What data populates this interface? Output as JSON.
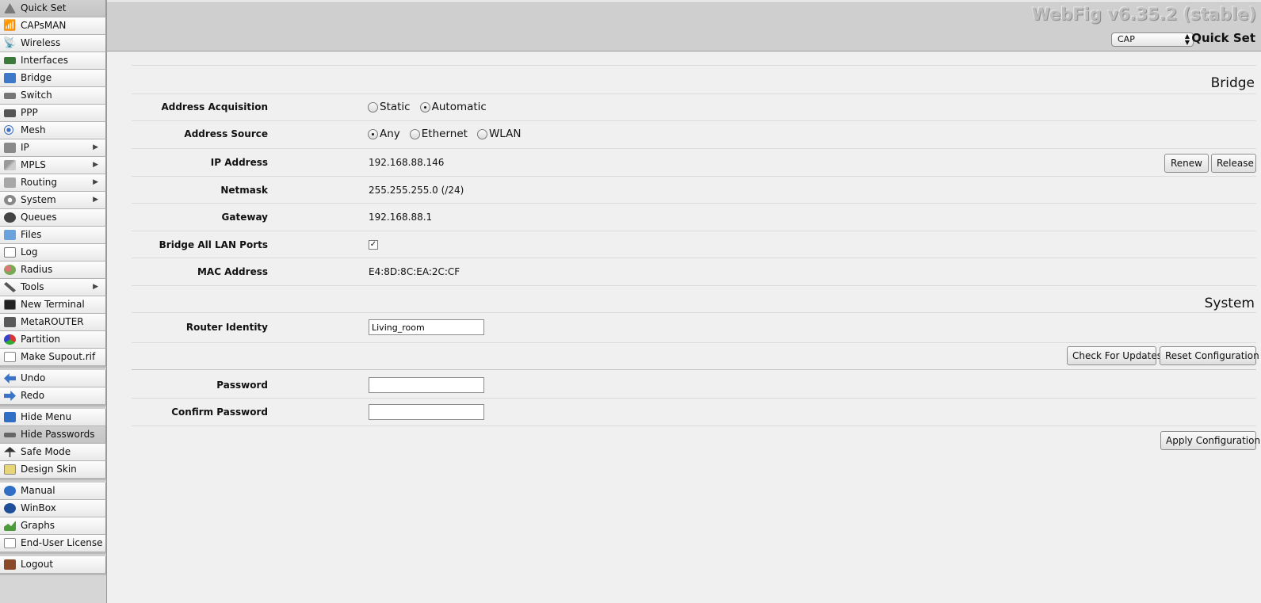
{
  "app": {
    "title": "WebFig v6.35.2 (stable)"
  },
  "header": {
    "mode_value": "CAP",
    "page_title": "Quick Set"
  },
  "sidebar": {
    "group1": [
      {
        "label": "Quick Set",
        "icon": "quickset-icon",
        "active": true
      },
      {
        "label": "CAPsMAN",
        "icon": "capsman-icon"
      },
      {
        "label": "Wireless",
        "icon": "wireless-icon"
      },
      {
        "label": "Interfaces",
        "icon": "interfaces-icon"
      },
      {
        "label": "Bridge",
        "icon": "bridge-icon"
      },
      {
        "label": "Switch",
        "icon": "switch-icon"
      },
      {
        "label": "PPP",
        "icon": "ppp-icon"
      },
      {
        "label": "Mesh",
        "icon": "mesh-icon"
      },
      {
        "label": "IP",
        "icon": "ip-icon",
        "submenu": true
      },
      {
        "label": "MPLS",
        "icon": "mpls-icon",
        "submenu": true
      },
      {
        "label": "Routing",
        "icon": "routing-icon",
        "submenu": true
      },
      {
        "label": "System",
        "icon": "system-icon",
        "submenu": true
      },
      {
        "label": "Queues",
        "icon": "queues-icon"
      },
      {
        "label": "Files",
        "icon": "files-icon"
      },
      {
        "label": "Log",
        "icon": "log-icon"
      },
      {
        "label": "Radius",
        "icon": "radius-icon"
      },
      {
        "label": "Tools",
        "icon": "tools-icon",
        "submenu": true
      },
      {
        "label": "New Terminal",
        "icon": "terminal-icon"
      },
      {
        "label": "MetaROUTER",
        "icon": "metarouter-icon"
      },
      {
        "label": "Partition",
        "icon": "partition-icon"
      },
      {
        "label": "Make Supout.rif",
        "icon": "supout-icon"
      }
    ],
    "group2": [
      {
        "label": "Undo",
        "icon": "undo-icon"
      },
      {
        "label": "Redo",
        "icon": "redo-icon"
      }
    ],
    "group3": [
      {
        "label": "Hide Menu",
        "icon": "hide-menu-icon"
      },
      {
        "label": "Hide Passwords",
        "icon": "hide-passwords-icon",
        "active": true
      },
      {
        "label": "Safe Mode",
        "icon": "safe-mode-icon"
      },
      {
        "label": "Design Skin",
        "icon": "design-skin-icon"
      }
    ],
    "group4": [
      {
        "label": "Manual",
        "icon": "manual-icon"
      },
      {
        "label": "WinBox",
        "icon": "winbox-icon"
      },
      {
        "label": "Graphs",
        "icon": "graphs-icon"
      },
      {
        "label": "End-User License",
        "icon": "license-icon"
      }
    ],
    "group5": [
      {
        "label": "Logout",
        "icon": "logout-icon"
      }
    ]
  },
  "bridge": {
    "section_title": "Bridge",
    "address_acquisition": {
      "label": "Address Acquisition",
      "options": [
        "Static",
        "Automatic"
      ],
      "selected": "Automatic"
    },
    "address_source": {
      "label": "Address Source",
      "options": [
        "Any",
        "Ethernet",
        "WLAN"
      ],
      "selected": "Any"
    },
    "ip_address": {
      "label": "IP Address",
      "value": "192.168.88.146"
    },
    "renew_label": "Renew",
    "release_label": "Release",
    "netmask": {
      "label": "Netmask",
      "value": "255.255.255.0 (/24)"
    },
    "gateway": {
      "label": "Gateway",
      "value": "192.168.88.1"
    },
    "bridge_all": {
      "label": "Bridge All LAN Ports",
      "checked": true
    },
    "mac": {
      "label": "MAC Address",
      "value": "E4:8D:8C:EA:2C:CF"
    }
  },
  "system": {
    "section_title": "System",
    "router_identity": {
      "label": "Router Identity",
      "value": "Living_room"
    },
    "check_updates_label": "Check For Updates",
    "reset_label": "Reset Configuration",
    "password": {
      "label": "Password",
      "value": ""
    },
    "confirm_password": {
      "label": "Confirm Password",
      "value": ""
    },
    "apply_label": "Apply Configuration"
  },
  "colors": {
    "header_bg": "#cfcfcf",
    "page_bg": "#f0f0f0",
    "sidebar_bg": "#d6d6d6"
  }
}
